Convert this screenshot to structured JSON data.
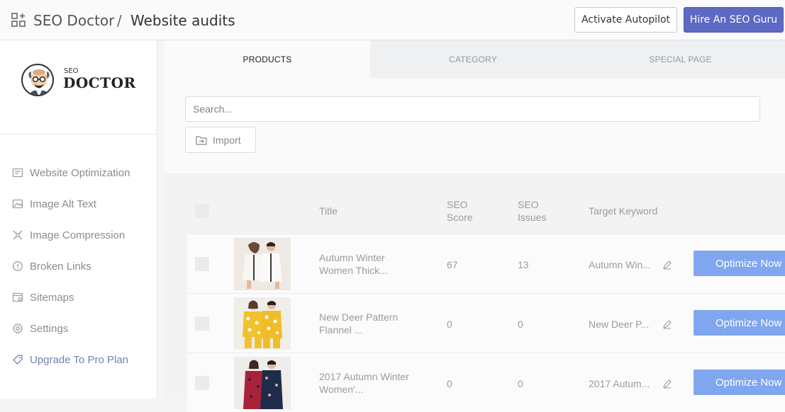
{
  "header": {
    "app_name": "SEO Doctor",
    "separator": "/",
    "page_title": "Website audits",
    "autopilot_label": "Activate Autopilot",
    "guru_label": "Hire An SEO Guru"
  },
  "logo": {
    "small": "SEO",
    "big": "DOCTOR"
  },
  "sidebar": {
    "items": [
      {
        "label": "Website Optimization",
        "icon": "website-optimization-icon"
      },
      {
        "label": "Image Alt Text",
        "icon": "image-icon"
      },
      {
        "label": "Image Compression",
        "icon": "compress-icon"
      },
      {
        "label": "Broken Links",
        "icon": "alert-icon"
      },
      {
        "label": "Sitemaps",
        "icon": "sitemap-icon"
      },
      {
        "label": "Settings",
        "icon": "gear-icon"
      },
      {
        "label": "Upgrade To Pro Plan",
        "icon": "tag-icon"
      }
    ]
  },
  "tabs": [
    {
      "label": "PRODUCTS",
      "active": true
    },
    {
      "label": "CATEGORY",
      "active": false
    },
    {
      "label": "SPECIAL PAGE",
      "active": false
    }
  ],
  "search": {
    "placeholder": "Search...",
    "value": ""
  },
  "import_label": "Import",
  "table": {
    "headers": {
      "title": "Title",
      "seo_score": "SEO\nScore",
      "seo_issues": "SEO\nIssues",
      "target_keyword": "Target Keyword"
    },
    "rows": [
      {
        "title": "Autumn Winter\nWomen Thick...",
        "score": "67",
        "issues": "13",
        "keyword": "Autumn Win...",
        "action": "Optimize Now"
      },
      {
        "title": "New Deer Pattern\nFlannel ...",
        "score": "0",
        "issues": "0",
        "keyword": "New Deer P...",
        "action": "Optimize Now"
      },
      {
        "title": "2017 Autumn Winter\nWomen'...",
        "score": "0",
        "issues": "0",
        "keyword": "2017 Autum...",
        "action": "Optimize Now"
      }
    ]
  },
  "colors": {
    "primary": "#5c6ac4",
    "optimize": "#7fa6ef",
    "pro_link": "#6f83b3"
  }
}
